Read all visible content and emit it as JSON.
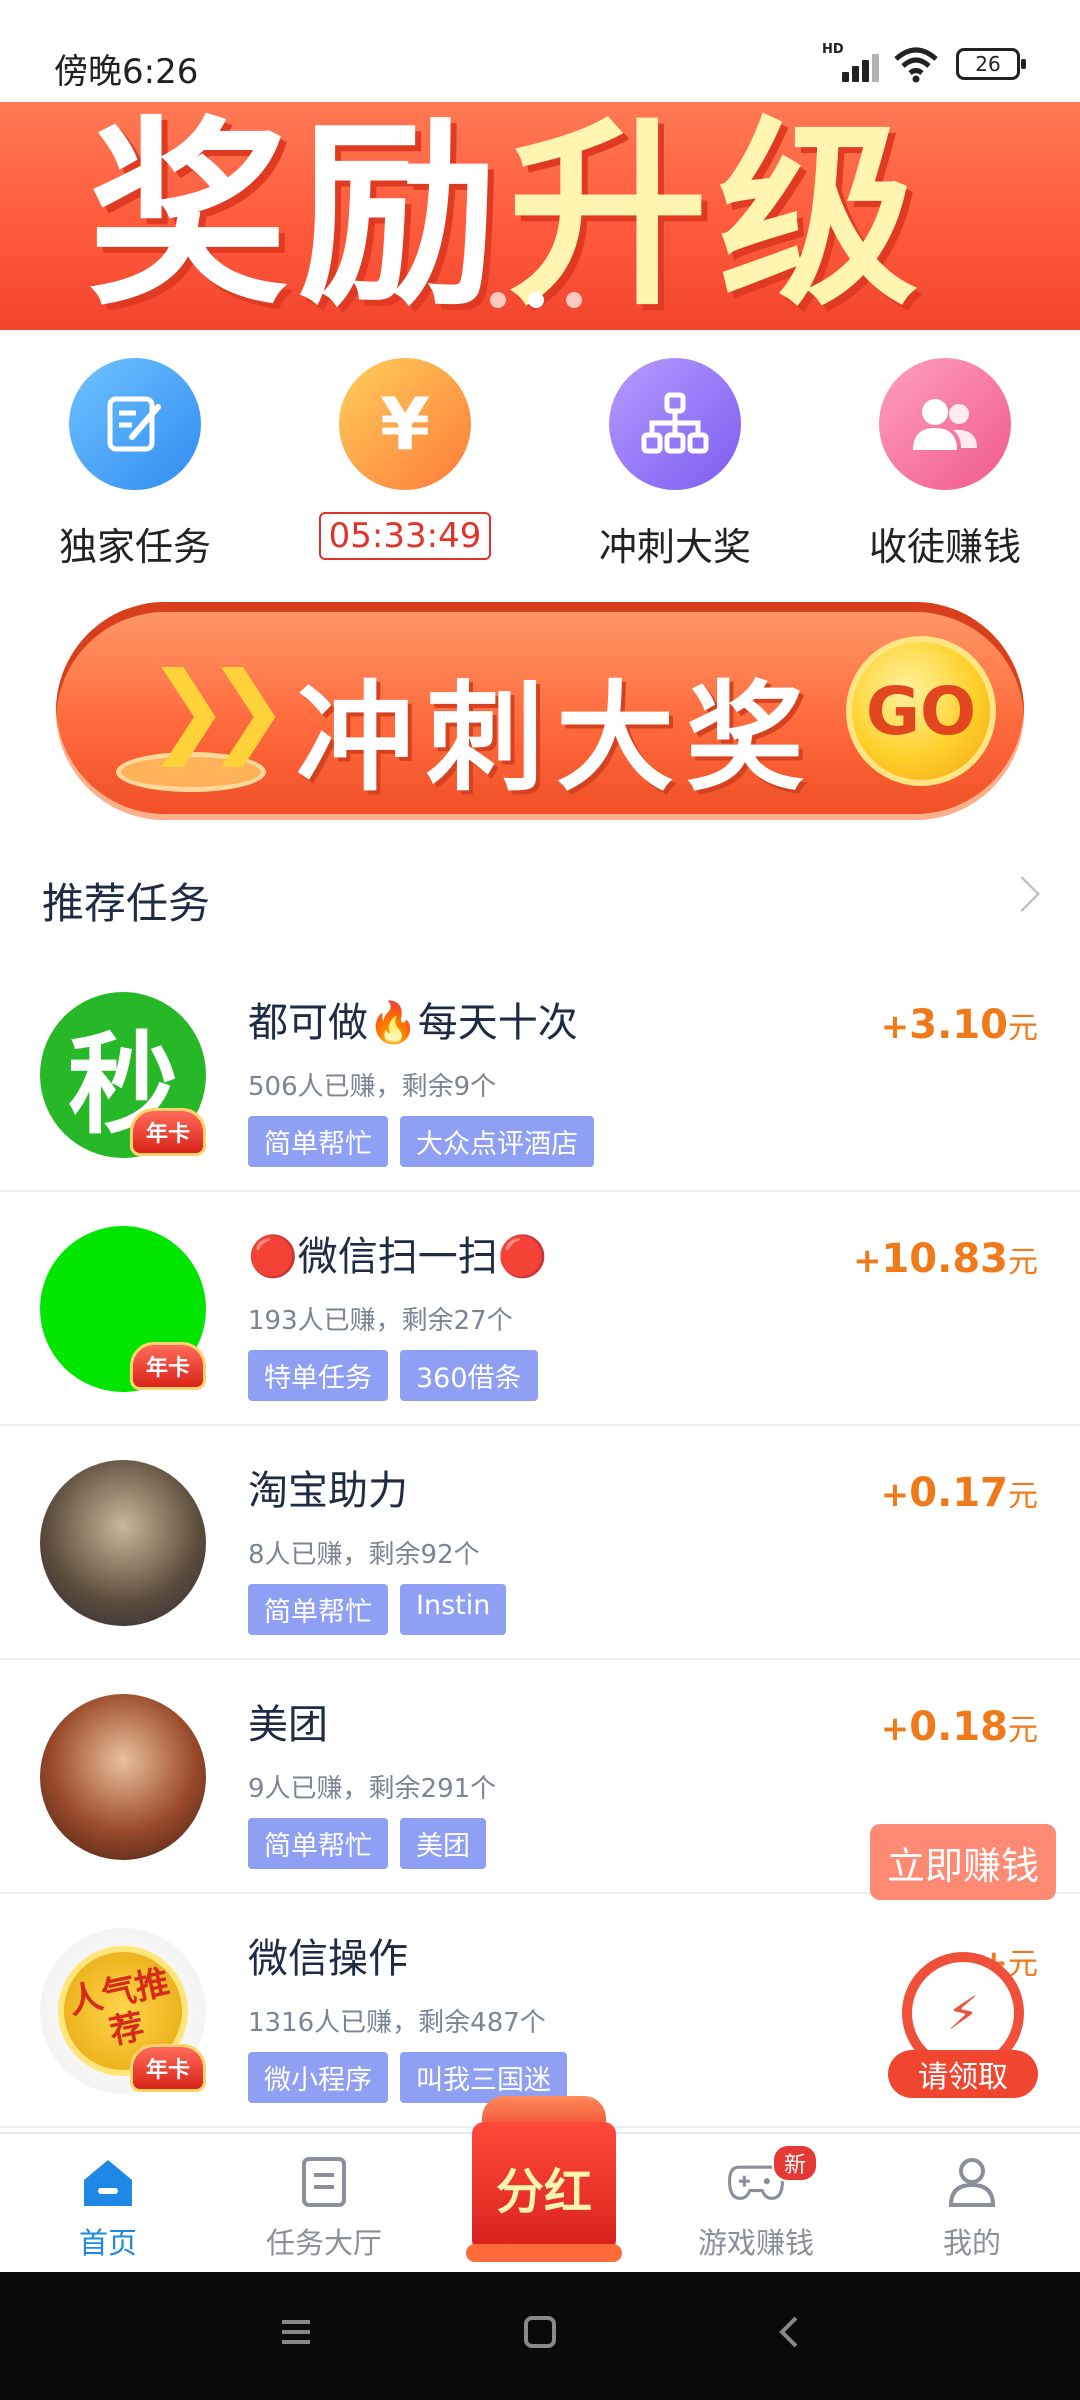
{
  "status": {
    "time": "傍晚6:26",
    "battery": "26",
    "network_badge": "HD"
  },
  "banner": {
    "title_a": "奖励",
    "title_b": "升级",
    "slides": 3,
    "active_slide": 1
  },
  "quick_actions": [
    {
      "label": "独家任务",
      "icon": "edit-icon"
    },
    {
      "countdown": "05:33:49",
      "icon": "yen-icon"
    },
    {
      "label": "冲刺大奖",
      "icon": "hierarchy-icon"
    },
    {
      "label": "收徒赚钱",
      "icon": "people-icon"
    }
  ],
  "sprint_banner": {
    "text": "冲刺大奖",
    "go": "GO"
  },
  "section": {
    "title": "推荐任务"
  },
  "tasks": [
    {
      "avatar_text": "秒",
      "badge": "年卡",
      "title": "都可做🔥每天十次",
      "stats": "506人已赚，剩余9个",
      "tags": [
        "简单帮忙",
        "大众点评酒店"
      ],
      "reward_sign": "+",
      "reward": "3.10",
      "unit": "元"
    },
    {
      "badge": "年卡",
      "title": "🔴微信扫一扫🔴",
      "stats": "193人已赚，剩余27个",
      "tags": [
        "特单任务",
        "360借条"
      ],
      "reward_sign": "+",
      "reward": "10.83",
      "unit": "元"
    },
    {
      "title": "淘宝助力",
      "stats": "8人已赚，剩余92个",
      "tags": [
        "简单帮忙",
        "Instin"
      ],
      "reward_sign": "+",
      "reward": "0.17",
      "unit": "元"
    },
    {
      "title": "美团",
      "stats": "9人已赚，剩余291个",
      "tags": [
        "简单帮忙",
        "美团"
      ],
      "reward_sign": "+",
      "reward": "0.18",
      "unit": "元"
    },
    {
      "avatar_text": "人气推荐",
      "badge": "年卡",
      "title": "微信操作",
      "stats": "1316人已赚，剩余487个",
      "tags": [
        "微小程序",
        "叫我三国迷"
      ],
      "reward_sign": "+",
      "reward": "",
      "unit": "元"
    }
  ],
  "floating": {
    "earn_now": "立即赚钱",
    "claim": "请领取"
  },
  "bottom_nav": [
    {
      "label": "首页",
      "active": true
    },
    {
      "label": "任务大厅"
    },
    {
      "label": "分红"
    },
    {
      "label": "游戏赚钱",
      "badge": "新"
    },
    {
      "label": "我的"
    }
  ],
  "colors": {
    "accent_blue": "#1e88e5",
    "reward_orange": "#f07a1a",
    "tag_purple": "#8fa0f4",
    "banner_red": "#ff5a3c"
  }
}
